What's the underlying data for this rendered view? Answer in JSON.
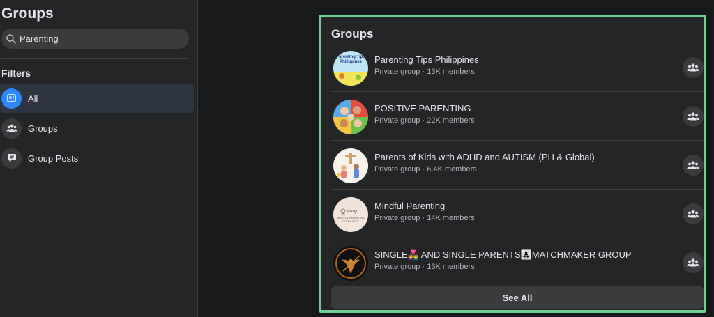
{
  "sidebar": {
    "title": "Groups",
    "search": {
      "value": "Parenting"
    },
    "filters_title": "Filters",
    "filters": [
      {
        "label": "All",
        "active": true,
        "icon": "feed-icon"
      },
      {
        "label": "Groups",
        "active": false,
        "icon": "people-icon"
      },
      {
        "label": "Group Posts",
        "active": false,
        "icon": "post-icon"
      }
    ]
  },
  "results": {
    "title": "Groups",
    "groups": [
      {
        "name": "Parenting Tips Philippines",
        "privacy": "Private group",
        "members": "13K members",
        "avatar_text": "Parenting Tips Philippines"
      },
      {
        "name": "POSITIVE PARENTING",
        "privacy": "Private group",
        "members": "22K members",
        "avatar_text": ""
      },
      {
        "name": "Parents of Kids with ADHD and AUTISM (PH & Global)",
        "privacy": "Private group",
        "members": "6.4K members",
        "avatar_text": ""
      },
      {
        "name": "Mindful Parenting",
        "privacy": "Private group",
        "members": "14K members",
        "avatar_text": "MINDFUL PARENTING COMMUNITY"
      },
      {
        "name": "SINGLE👩‍❤️‍👨 AND SINGLE PARENTS👨‍👧‍👦MATCHMAKER GROUP",
        "privacy": "Private group",
        "members": "13K members",
        "avatar_text": ""
      }
    ],
    "see_all": "See All"
  },
  "colors": {
    "accent": "#2d88ff",
    "highlight_border": "#6fcf97"
  }
}
